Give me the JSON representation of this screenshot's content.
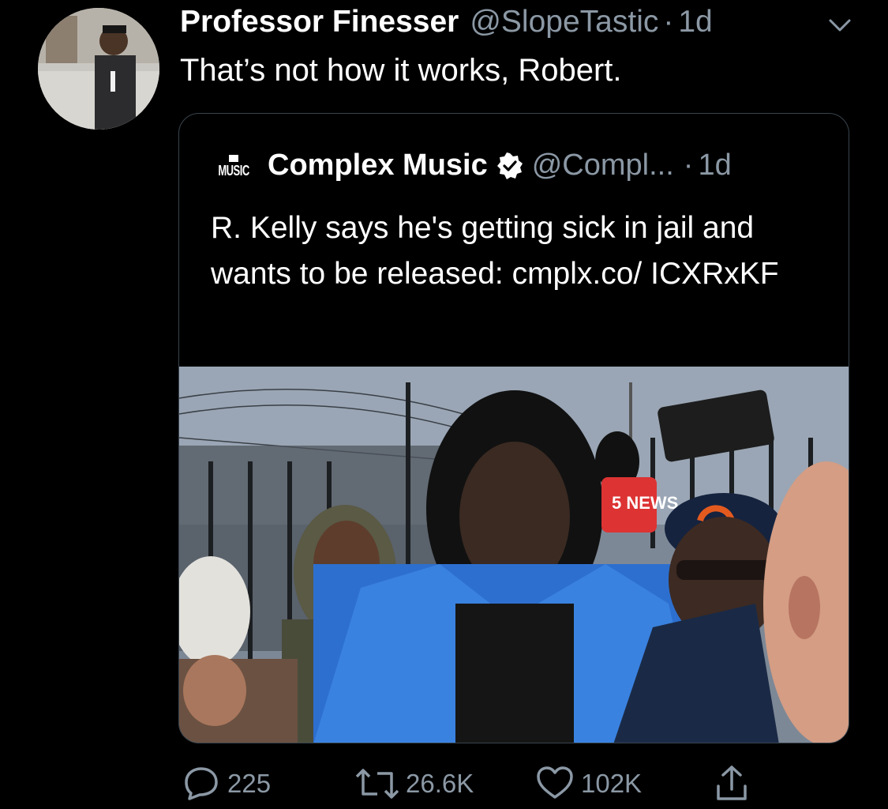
{
  "tweet": {
    "display_name": "Professor Finesser",
    "handle": "@SlopeTastic",
    "separator": "·",
    "time": "1d",
    "text": "That’s not how it works, Robert."
  },
  "quoted_tweet": {
    "logo_text": "MUSIC",
    "display_name": "Complex Music",
    "handle": "@Compl...",
    "separator": "·",
    "time": "1d",
    "text": "R. Kelly says he's getting sick in jail and wants to be released: cmplx.co/ ICXRxKF",
    "photo_sign_text": "5 NEWS"
  },
  "actions": {
    "replies": "225",
    "retweets": "26.6K",
    "likes": "102K"
  },
  "colors": {
    "background": "#000000",
    "secondary_text": "#8b98a5",
    "quote_border": "#38444d"
  }
}
